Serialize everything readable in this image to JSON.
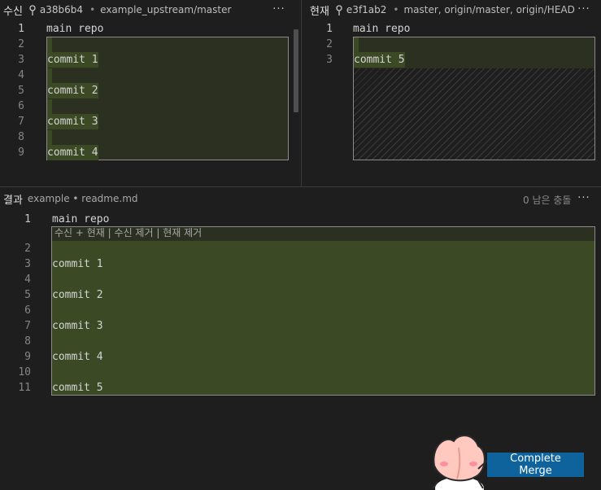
{
  "incoming": {
    "title": "수신",
    "hash": "a38b6b4",
    "dot": "•",
    "ref": "example_upstream/master",
    "more": "···",
    "lines": [
      {
        "num": "1",
        "text": "main repo"
      },
      {
        "num": "2",
        "text": ""
      },
      {
        "num": "3",
        "text": "commit 1"
      },
      {
        "num": "4",
        "text": ""
      },
      {
        "num": "5",
        "text": "commit 2"
      },
      {
        "num": "6",
        "text": ""
      },
      {
        "num": "7",
        "text": "commit 3"
      },
      {
        "num": "8",
        "text": ""
      },
      {
        "num": "9",
        "text": "commit 4"
      }
    ]
  },
  "current": {
    "title": "현재",
    "hash": "e3f1ab2",
    "dot": "•",
    "ref": "master, origin/master, origin/HEAD",
    "more": "···",
    "lines": [
      {
        "num": "1",
        "text": "main repo"
      },
      {
        "num": "2",
        "text": ""
      },
      {
        "num": "3",
        "text": "commit 5"
      }
    ]
  },
  "result": {
    "title": "결과",
    "file": "example • readme.md",
    "conflicts": "0 남은 충돌",
    "more": "···",
    "codelens": {
      "accept_both": "수신 + 현재",
      "sep1": " | ",
      "remove_incoming": "수신 제거",
      "sep2": " | ",
      "remove_current": "현재 제거"
    },
    "lines": [
      {
        "num": "1",
        "text": "main repo"
      },
      {
        "num": "2",
        "text": ""
      },
      {
        "num": "3",
        "text": "commit 1"
      },
      {
        "num": "4",
        "text": ""
      },
      {
        "num": "5",
        "text": "commit 2"
      },
      {
        "num": "6",
        "text": ""
      },
      {
        "num": "7",
        "text": "commit 3"
      },
      {
        "num": "8",
        "text": ""
      },
      {
        "num": "9",
        "text": "commit 4"
      },
      {
        "num": "10",
        "text": ""
      },
      {
        "num": "11",
        "text": "commit 5"
      }
    ]
  },
  "complete_merge_label": "Complete Merge",
  "colors": {
    "background": "#1e1e1e",
    "change_highlight": "#3b4a25",
    "button": "#0e639c"
  }
}
